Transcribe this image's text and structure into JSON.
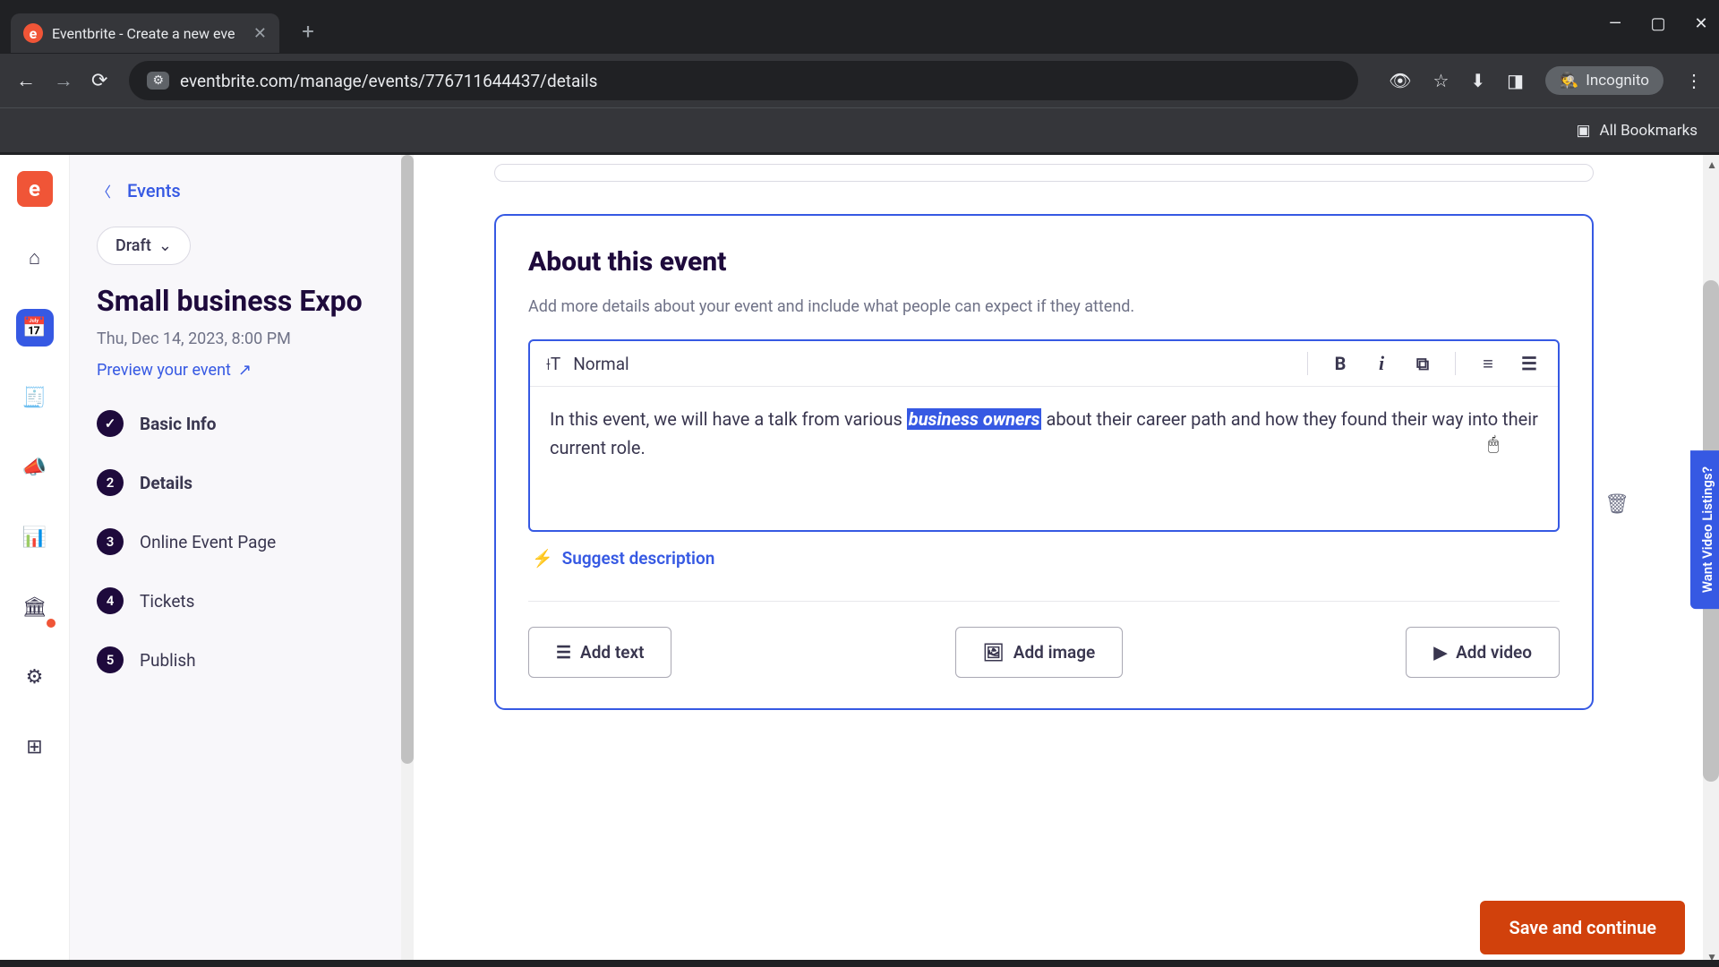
{
  "browser": {
    "tab_title": "Eventbrite - Create a new eve",
    "new_tab": "+",
    "url": "eventbrite.com/manage/events/776711644437/details",
    "incognito_label": "Incognito",
    "bookmarks_label": "All Bookmarks"
  },
  "sidebar": {
    "events_link": "Events",
    "status": "Draft",
    "event_title": "Small business Expo",
    "event_date": "Thu, Dec 14, 2023, 8:00 PM",
    "preview_label": "Preview your event",
    "steps": [
      {
        "num": "✓",
        "label": "Basic Info"
      },
      {
        "num": "2",
        "label": "Details"
      },
      {
        "num": "3",
        "label": "Online Event Page"
      },
      {
        "num": "4",
        "label": "Tickets"
      },
      {
        "num": "5",
        "label": "Publish"
      }
    ]
  },
  "editor": {
    "card_title": "About this event",
    "card_sub": "Add more details about your event and include what people can expect if they attend.",
    "format_label": "Normal",
    "text_before": "In this event, we will have a talk from various ",
    "text_selected": "business owners",
    "text_after": " about their career path and how they found their way into their current role.",
    "suggest_label": "Suggest description",
    "add_text": "Add text",
    "add_image": "Add image",
    "add_video": "Add video"
  },
  "footer": {
    "save_label": "Save and continue"
  },
  "side_tab": "Want Video Listings?",
  "brand_letter": "e"
}
